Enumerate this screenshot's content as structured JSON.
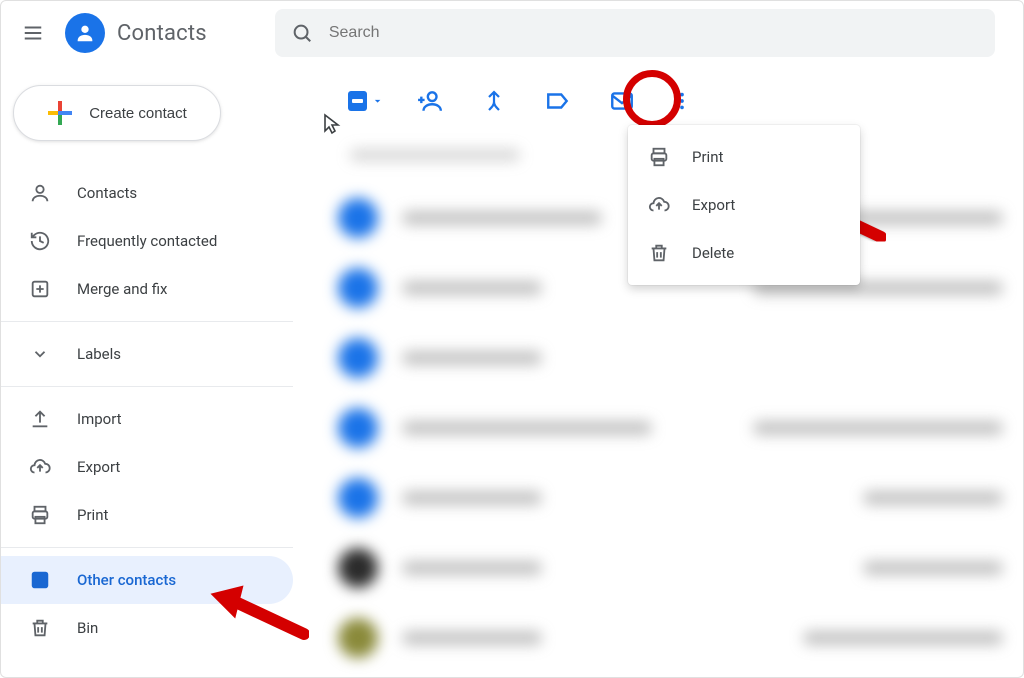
{
  "app": {
    "name": "Contacts"
  },
  "search": {
    "placeholder": "Search"
  },
  "create": {
    "label": "Create contact"
  },
  "sidebar": {
    "main": [
      {
        "label": "Contacts"
      },
      {
        "label": "Frequently contacted"
      },
      {
        "label": "Merge and fix"
      }
    ],
    "labels_heading": "Labels",
    "tools": [
      {
        "label": "Import"
      },
      {
        "label": "Export"
      },
      {
        "label": "Print"
      }
    ],
    "bottom": [
      {
        "label": "Other contacts"
      },
      {
        "label": "Bin"
      }
    ]
  },
  "overflow": {
    "items": [
      {
        "label": "Print"
      },
      {
        "label": "Export"
      },
      {
        "label": "Delete"
      }
    ]
  },
  "colors": {
    "accent": "#1a73e8",
    "annotation": "#d40000"
  }
}
